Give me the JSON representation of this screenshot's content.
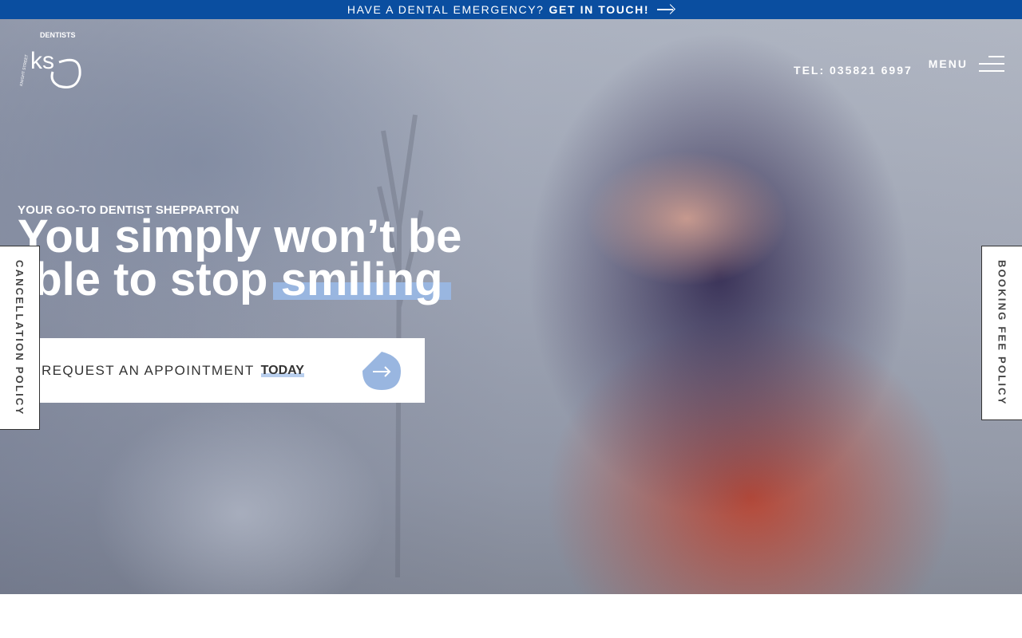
{
  "topbar": {
    "text": "HAVE A DENTAL EMERGENCY?",
    "link": "GET IN TOUCH!",
    "background": "#0a4ea0"
  },
  "header": {
    "logo_text": "DENTISTS",
    "logo_initials": "ks",
    "logo_sub": "KNIGHT STREET",
    "phone": "TEL: 035821 6997",
    "menu_label": "MENU",
    "menu_icon": "hamburger-icon"
  },
  "hero": {
    "eyebrow": "YOUR GO-TO DENTIST SHEPPARTON",
    "headline_line1": "You simply won’t be",
    "headline_line2_start": "able to stop ",
    "headline_highlight": "smiling",
    "highlight_color": "#99b6e0"
  },
  "cta": {
    "label": "REQUEST AN APPOINTMENT",
    "label_strong": "TODAY",
    "icon": "arrow-right-icon",
    "icon_color": "#99b6e0"
  },
  "side_tabs": {
    "left": "CANCELLATION POLICY",
    "right": "BOOKING FEE POLICY"
  }
}
